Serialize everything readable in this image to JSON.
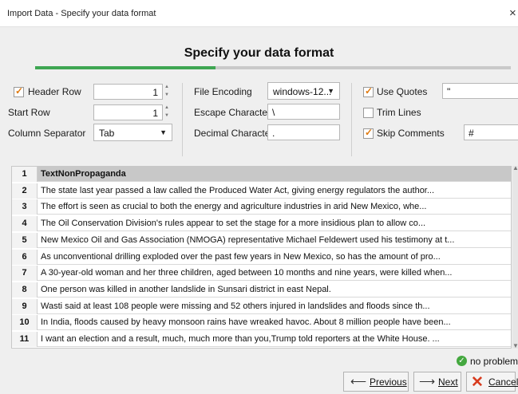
{
  "window": {
    "title": "Import Data - Specify your data format",
    "close_glyph": "×"
  },
  "header": {
    "title": "Specify your data format",
    "progress": 0.38
  },
  "options": {
    "header_row": {
      "label": "Header Row",
      "checked": true,
      "value": "1"
    },
    "start_row": {
      "label": "Start Row",
      "value": "1"
    },
    "column_separator": {
      "label": "Column Separator",
      "value": "Tab"
    },
    "file_encoding": {
      "label": "File Encoding",
      "value": "windows-12..."
    },
    "escape_character": {
      "label": "Escape Character",
      "value": "\\"
    },
    "decimal_character": {
      "label": "Decimal Character",
      "value": "."
    },
    "use_quotes": {
      "label": "Use Quotes",
      "checked": true,
      "value": "\""
    },
    "trim_lines": {
      "label": "Trim Lines",
      "checked": false
    },
    "skip_comments": {
      "label": "Skip Comments",
      "checked": true,
      "value": "#"
    }
  },
  "table": {
    "rows": [
      {
        "num": "1",
        "text": "TextNonPropaganda"
      },
      {
        "num": "2",
        "text": "The state last year passed a law called the Produced Water Act, giving energy regulators the author..."
      },
      {
        "num": "3",
        "text": "The effort is seen as crucial to both the energy and agriculture industries in arid New Mexico, whe..."
      },
      {
        "num": "4",
        "text": "The Oil Conservation Division's rules appear to set the stage for a more insidious plan to allow co..."
      },
      {
        "num": "5",
        "text": "New Mexico Oil and Gas Association (NMOGA) representative Michael Feldewert used his testimony at t..."
      },
      {
        "num": "6",
        "text": "As unconventional drilling exploded over the past few years in New Mexico, so has the amount of pro..."
      },
      {
        "num": "7",
        "text": "A 30-year-old woman and her three children, aged between 10 months and nine years, were killed when..."
      },
      {
        "num": "8",
        "text": "One person was killed in another landslide in Sunsari district in east Nepal."
      },
      {
        "num": "9",
        "text": "Wasti said at least 108 people were missing and 52 others injured in landslides and floods since th..."
      },
      {
        "num": "10",
        "text": "In India, floods caused by heavy monsoon rains have wreaked havoc. About 8 million people have been..."
      },
      {
        "num": "11",
        "text": "I want an election and a result, much, much more than you,Trump told reporters at the White House. ..."
      }
    ]
  },
  "status": {
    "text": "no problems",
    "color": "#44a83f"
  },
  "buttons": {
    "previous": "Previous",
    "next": "Next",
    "cancel": "Cancel"
  },
  "icons": {
    "previous": "arrow-left-icon",
    "next": "arrow-right-icon",
    "cancel": "cancel-x-icon",
    "status": "check-circle-icon"
  }
}
